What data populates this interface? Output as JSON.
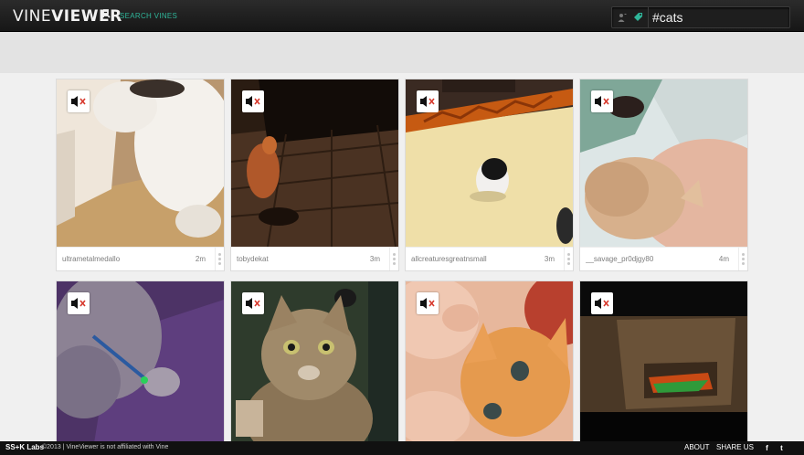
{
  "header": {
    "logo_thin": "VINE",
    "logo_bold": "VIEWER",
    "search_link": "SEARCH VINES",
    "search_value": "#cats",
    "accent": "#2fb69a"
  },
  "icons": {
    "user": "user-icon",
    "tag": "tag-icon",
    "mute": "speaker-muted-icon",
    "more": "vertical-dots-icon"
  },
  "cards": [
    {
      "username": "ultrametalmedallo",
      "age": "2m"
    },
    {
      "username": "tobydekat",
      "age": "3m"
    },
    {
      "username": "allcreaturesgreatnsmall",
      "age": "3m"
    },
    {
      "username": "__savage_pr0djgy80",
      "age": "4m"
    },
    {
      "username": "",
      "age": ""
    },
    {
      "username": "",
      "age": ""
    },
    {
      "username": "",
      "age": ""
    },
    {
      "username": "",
      "age": ""
    }
  ],
  "footer": {
    "brand": "SS+K Labs",
    "copyright": "©2013 | VineViewer is not affiliated with Vine",
    "about": "ABOUT",
    "share": "SHARE US",
    "facebook": "f",
    "twitter": "t"
  }
}
